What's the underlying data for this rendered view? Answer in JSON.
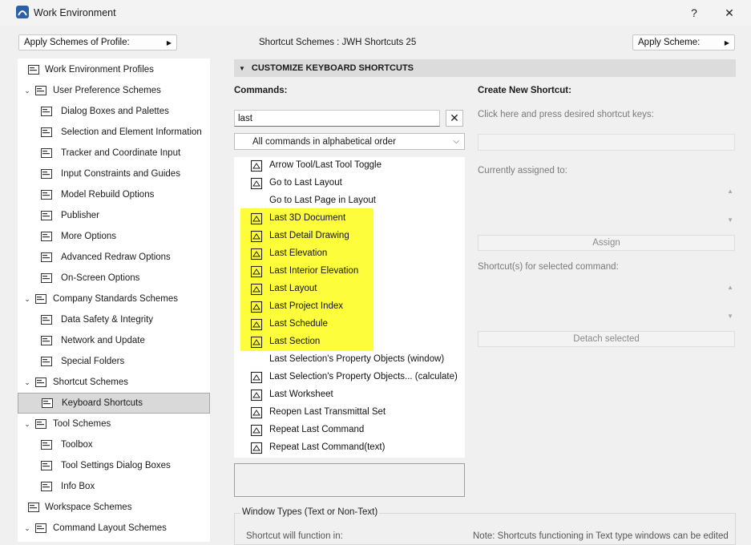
{
  "window": {
    "title": "Work Environment",
    "help": "?",
    "close": "✕"
  },
  "toolbar": {
    "apply_profile": "Apply Schemes of Profile:",
    "scheme_label": "Shortcut Schemes :  JWH Shortcuts 25",
    "apply_scheme": "Apply Scheme:"
  },
  "tree": [
    {
      "label": "Work Environment Profiles",
      "icon": "profiles-icon",
      "level": 0,
      "expand": ""
    },
    {
      "label": "User Preference Schemes",
      "icon": "user-preferences-icon",
      "level": 0,
      "expand": "⌄"
    },
    {
      "label": "Dialog Boxes and Palettes",
      "icon": "dialog-boxes-icon",
      "level": 1,
      "expand": ""
    },
    {
      "label": "Selection and Element Information",
      "icon": "selection-icon",
      "level": 1,
      "expand": ""
    },
    {
      "label": "Tracker and Coordinate Input",
      "icon": "xyz-tracker-icon",
      "level": 1,
      "expand": ""
    },
    {
      "label": "Input Constraints and Guides",
      "icon": "input-constraints-icon",
      "level": 1,
      "expand": ""
    },
    {
      "label": "Model Rebuild Options",
      "icon": "model-rebuild-icon",
      "level": 1,
      "expand": ""
    },
    {
      "label": "Publisher",
      "icon": "publisher-icon",
      "level": 1,
      "expand": ""
    },
    {
      "label": "More Options",
      "icon": "sliders-icon",
      "level": 1,
      "expand": ""
    },
    {
      "label": "Advanced Redraw Options",
      "icon": "redraw-icon",
      "level": 1,
      "expand": ""
    },
    {
      "label": "On-Screen Options",
      "icon": "on-screen-icon",
      "level": 1,
      "expand": ""
    },
    {
      "label": "Company Standards Schemes",
      "icon": "company-standards-icon",
      "level": 0,
      "expand": "⌄"
    },
    {
      "label": "Data Safety & Integrity",
      "icon": "data-safety-icon",
      "level": 1,
      "expand": ""
    },
    {
      "label": "Network and Update",
      "icon": "globe-icon",
      "level": 1,
      "expand": ""
    },
    {
      "label": "Special Folders",
      "icon": "folder-icon",
      "level": 1,
      "expand": ""
    },
    {
      "label": "Shortcut Schemes",
      "icon": "shortcut-schemes-icon",
      "level": 0,
      "expand": "⌄"
    },
    {
      "label": "Keyboard Shortcuts",
      "icon": "keyboard-shortcuts-icon",
      "level": 1,
      "expand": "",
      "selected": true
    },
    {
      "label": "Tool Schemes",
      "icon": "tool-schemes-icon",
      "level": 0,
      "expand": "⌄"
    },
    {
      "label": "Toolbox",
      "icon": "toolbox-icon",
      "level": 1,
      "expand": ""
    },
    {
      "label": "Tool Settings Dialog Boxes",
      "icon": "tool-settings-icon",
      "level": 1,
      "expand": ""
    },
    {
      "label": "Info Box",
      "icon": "info-box-icon",
      "level": 1,
      "expand": ""
    },
    {
      "label": "Workspace Schemes",
      "icon": "workspace-icon",
      "level": 0,
      "expand": ""
    },
    {
      "label": "Command Layout Schemes",
      "icon": "command-layout-icon",
      "level": 0,
      "expand": "⌄"
    }
  ],
  "section": {
    "title": "CUSTOMIZE KEYBOARD SHORTCUTS"
  },
  "commands": {
    "heading": "Commands:",
    "search_value": "last",
    "clear": "✕",
    "order": "All commands in alphabetical order",
    "items": [
      {
        "label": "Arrow Tool/Last Tool Toggle",
        "icon": "arrow-tool-icon"
      },
      {
        "label": "Go to Last Layout",
        "icon": "go-layout-icon"
      },
      {
        "label": "Go to Last Page in Layout",
        "icon": ""
      },
      {
        "label": "Last 3D Document",
        "icon": "3d-document-icon"
      },
      {
        "label": "Last Detail Drawing",
        "icon": "detail-drawing-icon"
      },
      {
        "label": "Last Elevation",
        "icon": "elevation-icon"
      },
      {
        "label": "Last Interior Elevation",
        "icon": "interior-elevation-icon"
      },
      {
        "label": "Last Layout",
        "icon": "layout-icon"
      },
      {
        "label": "Last Project Index",
        "icon": "project-index-icon"
      },
      {
        "label": "Last Schedule",
        "icon": "schedule-icon"
      },
      {
        "label": "Last Section",
        "icon": "section-icon"
      },
      {
        "label": "Last Selection's Property Objects (window)",
        "icon": ""
      },
      {
        "label": "Last Selection's Property Objects... (calculate)",
        "icon": "property-objects-icon"
      },
      {
        "label": "Last Worksheet",
        "icon": "worksheet-icon"
      },
      {
        "label": "Reopen Last Transmittal Set",
        "icon": "transmittal-icon"
      },
      {
        "label": "Repeat Last Command",
        "icon": "repeat-icon"
      },
      {
        "label": "Repeat Last Command(text)",
        "icon": "repeat-icon"
      }
    ]
  },
  "create": {
    "heading": "Create New Shortcut:",
    "hint": "Click here and press desired shortcut keys:",
    "assigned_label": "Currently assigned to:",
    "assign_button": "Assign",
    "selected_label": "Shortcut(s) for selected command:",
    "detach_button": "Detach selected"
  },
  "window_types": {
    "legend": "Window Types (Text or Non-Text)",
    "function_in": "Shortcut will function in:",
    "note": "Note: Shortcuts functioning in Text type windows can be edited"
  },
  "colors": {
    "highlight": "#fdfd3c",
    "selected_row": "#d9d9d9"
  }
}
